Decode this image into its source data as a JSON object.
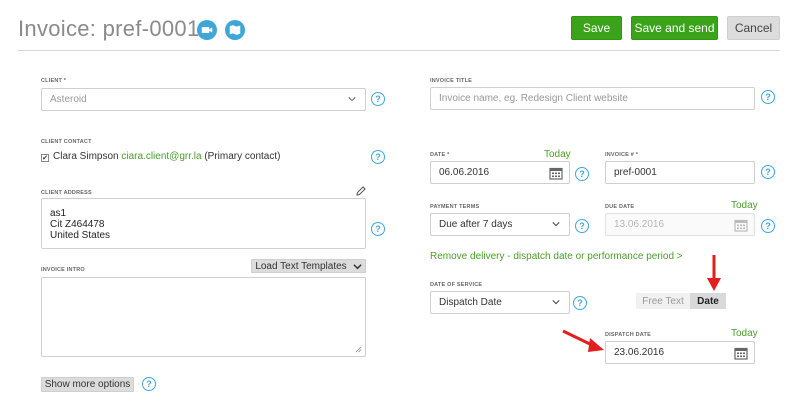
{
  "header": {
    "title": "Invoice: pref-0001",
    "save_label": "Save",
    "save_send_label": "Save and send",
    "cancel_label": "Cancel"
  },
  "client": {
    "label": "CLIENT *",
    "value": "Asteroid",
    "help": "?"
  },
  "client_contact": {
    "label": "CLIENT CONTACT",
    "name": "Clara Simpson",
    "email": "ciara.client@grr.la",
    "suffix": "(Primary contact)",
    "checked": true
  },
  "client_address": {
    "label": "CLIENT ADDRESS",
    "lines": [
      "as1",
      "Cit Z464478",
      "United States"
    ]
  },
  "invoice_intro": {
    "label": "INVOICE INTRO",
    "load_templates_label": "Load Text Templates"
  },
  "show_more_label": "Show more options",
  "invoice_title": {
    "label": "INVOICE TITLE",
    "placeholder": "Invoice name, eg. Redesign Client website"
  },
  "date": {
    "label": "DATE *",
    "today": "Today",
    "value": "06.06.2016"
  },
  "invoice_number": {
    "label": "INVOICE # *",
    "value": "pref-0001"
  },
  "payment_terms": {
    "label": "PAYMENT TERMS",
    "value": "Due after 7 days"
  },
  "due_date": {
    "label": "DUE DATE",
    "today": "Today",
    "value": "13.06.2016"
  },
  "remove_delivery_link": "Remove delivery - dispatch date or performance period >",
  "date_of_service": {
    "label": "DATE OF SERVICE",
    "value": "Dispatch Date"
  },
  "toggle": {
    "free_text": "Free Text",
    "date": "Date"
  },
  "dispatch_date": {
    "label": "DISPATCH DATE",
    "today": "Today",
    "value": "23.06.2016"
  },
  "colors": {
    "accent_green": "#3aa31a",
    "help_blue": "#3fa6d8",
    "arrow_red": "#e31e1e"
  }
}
